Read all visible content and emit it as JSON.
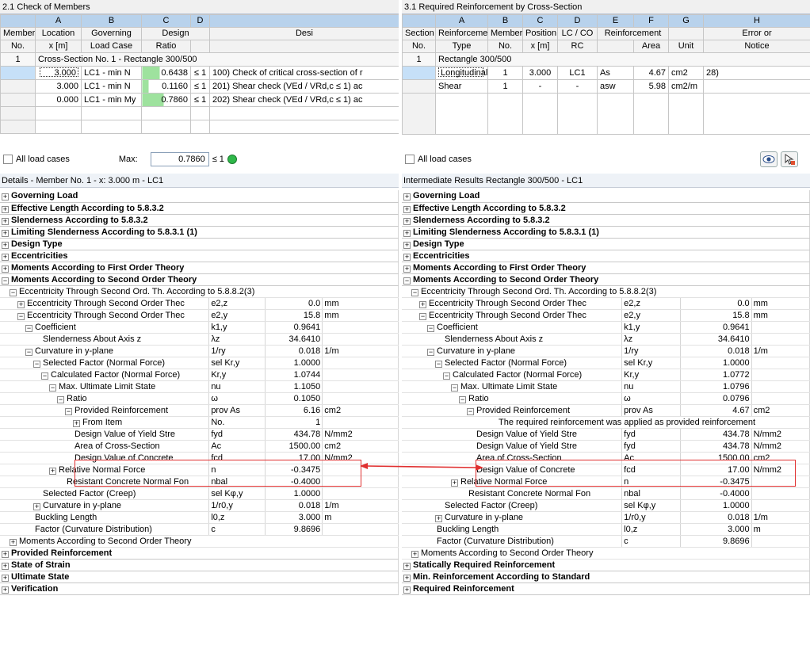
{
  "left": {
    "title": "2.1 Check of Members",
    "letters": [
      "A",
      "B",
      "C",
      "D"
    ],
    "header1": [
      "Member",
      "Location",
      "Governing",
      "Design",
      "",
      "Desi"
    ],
    "header2": [
      "No.",
      "x [m]",
      "Load Case",
      "Ratio",
      ""
    ],
    "group_no": "1",
    "group_label": "Cross-Section No. 1 - Rectangle 300/500",
    "rows": [
      {
        "x": "3.000",
        "lc": "LC1 - min N",
        "ratio": "0.6438",
        "le": "≤ 1",
        "desc": "100) Check of critical cross-section of r"
      },
      {
        "x": "3.000",
        "lc": "LC1 - min N",
        "ratio": "0.1160",
        "le": "≤ 1",
        "desc": "201) Shear check (VEd / VRd,c ≤ 1) ac"
      },
      {
        "x": "0.000",
        "lc": "LC1 - min My",
        "ratio": "0.7860",
        "le": "≤ 1",
        "desc": "202) Shear check (VEd / VRd,c ≤ 1) ac"
      }
    ],
    "all_load_cases": "All load cases",
    "max_label": "Max:",
    "max_value": "0.7860",
    "max_le": "≤ 1",
    "details_title": "Details  -  Member No. 1  -  x: 3.000 m  -  LC1"
  },
  "right": {
    "title": "3.1 Required Reinforcement by Cross-Section",
    "letters": [
      "A",
      "B",
      "C",
      "D",
      "E",
      "F",
      "G",
      "H"
    ],
    "header1": [
      "Section",
      "Reinforcement",
      "Member",
      "Position",
      "LC / CO",
      "Reinforcement",
      "",
      "Error or"
    ],
    "header2": [
      "No.",
      "Type",
      "No.",
      "x [m]",
      "RC",
      "Area",
      "Unit",
      "Notice"
    ],
    "group_no": "1",
    "group_label": "Rectangle 300/500",
    "rows": [
      {
        "type": "Longitudinal",
        "member": "1",
        "pos": "3.000",
        "lc": "LC1",
        "sym": "As",
        "area": "4.67",
        "unit": "cm2",
        "note": "28)"
      },
      {
        "type": "Shear",
        "member": "1",
        "pos": "-",
        "lc": "-",
        "sym": "asw",
        "area": "5.98",
        "unit": "cm2/m",
        "note": ""
      }
    ],
    "all_load_cases": "All load cases",
    "details_title": "Intermediate Results Rectangle 300/500 - LC1"
  },
  "tree_left": [
    {
      "t": "Governing Load",
      "bold": true,
      "exp": "+"
    },
    {
      "t": "Effective Length According to 5.8.3.2",
      "bold": true,
      "exp": "+"
    },
    {
      "t": "Slenderness According to 5.8.3.2",
      "bold": true,
      "exp": "+"
    },
    {
      "t": "Limiting Slenderness According to 5.8.3.1 (1)",
      "bold": true,
      "exp": "+"
    },
    {
      "t": "Design Type",
      "bold": true,
      "exp": "+"
    },
    {
      "t": "Eccentricities",
      "bold": true,
      "exp": "+"
    },
    {
      "t": "Moments According to First Order Theory",
      "bold": true,
      "exp": "+"
    },
    {
      "t": "Moments According to Second Order Theory",
      "bold": true,
      "exp": "-"
    },
    {
      "t": "Eccentricity Through Second Ord. Th. According to 5.8.8.2(3)",
      "lvl": 1,
      "exp": "-",
      "span": true
    },
    {
      "t": "Eccentricity Through Second Order Thec",
      "lvl": 2,
      "exp": "+",
      "s": "e2,z",
      "v": "0.0",
      "u": "mm"
    },
    {
      "t": "Eccentricity Through Second Order Thec",
      "lvl": 2,
      "exp": "-",
      "s": "e2,y",
      "v": "15.8",
      "u": "mm"
    },
    {
      "t": "Coefficient",
      "lvl": 3,
      "exp": "-",
      "s": "k1,y",
      "v": "0.9641",
      "u": ""
    },
    {
      "t": "Slenderness About Axis z",
      "lvl": 4,
      "s": "λz",
      "v": "34.6410",
      "u": ""
    },
    {
      "t": "Curvature in y-plane",
      "lvl": 3,
      "exp": "-",
      "s": "1/ry",
      "v": "0.018",
      "u": "1/m"
    },
    {
      "t": "Selected Factor (Normal Force)",
      "lvl": 4,
      "exp": "-",
      "s": "sel Kr,y",
      "v": "1.0000",
      "u": ""
    },
    {
      "t": "Calculated Factor (Normal Force)",
      "lvl": 5,
      "exp": "-",
      "s": "Kr,y",
      "v": "1.0744",
      "u": ""
    },
    {
      "t": "Max. Ultimate Limit State",
      "lvl": 6,
      "exp": "-",
      "s": "nu",
      "v": "1.1050",
      "u": ""
    },
    {
      "t": "Ratio",
      "lvl": 7,
      "exp": "-",
      "s": "ω",
      "v": "0.1050",
      "u": ""
    },
    {
      "t": "Provided Reinforcement",
      "lvl": 8,
      "exp": "-",
      "s": "prov As",
      "v": "6.16",
      "u": "cm2"
    },
    {
      "t": "From Item",
      "lvl": 9,
      "exp": "+",
      "s": "No.",
      "v": "1",
      "u": ""
    },
    {
      "t": "Design Value of Yield Stre",
      "lvl": 8,
      "s": "fyd",
      "v": "434.78",
      "u": "N/mm2"
    },
    {
      "t": "Area of Cross-Section",
      "lvl": 8,
      "s": "Ac",
      "v": "1500.00",
      "u": "cm2"
    },
    {
      "t": "Design Value of Concrete",
      "lvl": 8,
      "s": "fcd",
      "v": "17.00",
      "u": "N/mm2"
    },
    {
      "t": "Relative Normal Force",
      "lvl": 6,
      "exp": "+",
      "s": "n",
      "v": "-0.3475",
      "u": ""
    },
    {
      "t": "Resistant Concrete Normal Fon",
      "lvl": 7,
      "s": "nbal",
      "v": "-0.4000",
      "u": ""
    },
    {
      "t": "Selected Factor (Creep)",
      "lvl": 4,
      "s": "sel Kφ,y",
      "v": "1.0000",
      "u": ""
    },
    {
      "t": "Curvature in y-plane",
      "lvl": 4,
      "exp": "+",
      "s": "1/r0,y",
      "v": "0.018",
      "u": "1/m"
    },
    {
      "t": "Buckling Length",
      "lvl": 3,
      "s": "l0,z",
      "v": "3.000",
      "u": "m"
    },
    {
      "t": "Factor (Curvature Distribution)",
      "lvl": 3,
      "s": "c",
      "v": "9.8696",
      "u": ""
    },
    {
      "t": "Moments According to Second Order Theory",
      "lvl": 1,
      "exp": "+",
      "span": true
    },
    {
      "t": "Provided Reinforcement",
      "bold": true,
      "exp": "+"
    },
    {
      "t": "State of Strain",
      "bold": true,
      "exp": "+"
    },
    {
      "t": "Ultimate State",
      "bold": true,
      "exp": "+"
    },
    {
      "t": "Verification",
      "bold": true,
      "exp": "+"
    }
  ],
  "tree_right": [
    {
      "t": "Governing Load",
      "bold": true,
      "exp": "+"
    },
    {
      "t": "Effective Length According to 5.8.3.2",
      "bold": true,
      "exp": "+"
    },
    {
      "t": "Slenderness According to 5.8.3.2",
      "bold": true,
      "exp": "+"
    },
    {
      "t": "Limiting Slenderness According to 5.8.3.1 (1)",
      "bold": true,
      "exp": "+"
    },
    {
      "t": "Design Type",
      "bold": true,
      "exp": "+"
    },
    {
      "t": "Eccentricities",
      "bold": true,
      "exp": "+"
    },
    {
      "t": "Moments According to First Order Theory",
      "bold": true,
      "exp": "+"
    },
    {
      "t": "Moments According to Second Order Theory",
      "bold": true,
      "exp": "-"
    },
    {
      "t": "Eccentricity Through Second Ord. Th. According to 5.8.8.2(3)",
      "lvl": 1,
      "exp": "-",
      "span": true
    },
    {
      "t": "Eccentricity Through Second Order Thec",
      "lvl": 2,
      "exp": "+",
      "s": "e2,z",
      "v": "0.0",
      "u": "mm"
    },
    {
      "t": "Eccentricity Through Second Order Thec",
      "lvl": 2,
      "exp": "-",
      "s": "e2,y",
      "v": "15.8",
      "u": "mm"
    },
    {
      "t": "Coefficient",
      "lvl": 3,
      "exp": "-",
      "s": "k1,y",
      "v": "0.9641",
      "u": ""
    },
    {
      "t": "Slenderness About Axis z",
      "lvl": 4,
      "s": "λz",
      "v": "34.6410",
      "u": ""
    },
    {
      "t": "Curvature in y-plane",
      "lvl": 3,
      "exp": "-",
      "s": "1/ry",
      "v": "0.018",
      "u": "1/m"
    },
    {
      "t": "Selected Factor (Normal Force)",
      "lvl": 4,
      "exp": "-",
      "s": "sel Kr,y",
      "v": "1.0000",
      "u": ""
    },
    {
      "t": "Calculated Factor (Normal Force)",
      "lvl": 5,
      "exp": "-",
      "s": "Kr,y",
      "v": "1.0772",
      "u": ""
    },
    {
      "t": "Max. Ultimate Limit State",
      "lvl": 6,
      "exp": "-",
      "s": "nu",
      "v": "1.0796",
      "u": ""
    },
    {
      "t": "Ratio",
      "lvl": 7,
      "exp": "-",
      "s": "ω",
      "v": "0.0796",
      "u": ""
    },
    {
      "t": "Provided Reinforcement",
      "lvl": 8,
      "exp": "-",
      "s": "prov As",
      "v": "4.67",
      "u": "cm2"
    },
    {
      "t": "The required reinforcement was applied as provided reinforcement",
      "lvl": 9,
      "span": true
    },
    {
      "t": "Design Value of Yield Stre",
      "lvl": 8,
      "s": "fyd",
      "v": "434.78",
      "u": "N/mm2"
    },
    {
      "t": "Design Value of Yield Stre",
      "lvl": 8,
      "s": "fyd",
      "v": "434.78",
      "u": "N/mm2"
    },
    {
      "t": "Area of Cross-Section",
      "lvl": 8,
      "s": "Ac",
      "v": "1500.00",
      "u": "cm2"
    },
    {
      "t": "Design Value of Concrete",
      "lvl": 8,
      "s": "fcd",
      "v": "17.00",
      "u": "N/mm2"
    },
    {
      "t": "Relative Normal Force",
      "lvl": 6,
      "exp": "+",
      "s": "n",
      "v": "-0.3475",
      "u": ""
    },
    {
      "t": "Resistant Concrete Normal Fon",
      "lvl": 7,
      "s": "nbal",
      "v": "-0.4000",
      "u": ""
    },
    {
      "t": "Selected Factor (Creep)",
      "lvl": 4,
      "s": "sel Kφ,y",
      "v": "1.0000",
      "u": ""
    },
    {
      "t": "Curvature in y-plane",
      "lvl": 4,
      "exp": "+",
      "s": "1/r0,y",
      "v": "0.018",
      "u": "1/m"
    },
    {
      "t": "Buckling Length",
      "lvl": 3,
      "s": "l0,z",
      "v": "3.000",
      "u": "m"
    },
    {
      "t": "Factor (Curvature Distribution)",
      "lvl": 3,
      "s": "c",
      "v": "9.8696",
      "u": ""
    },
    {
      "t": "Moments According to Second Order Theory",
      "lvl": 1,
      "exp": "+",
      "span": true
    },
    {
      "t": "Statically Required Reinforcement",
      "bold": true,
      "exp": "+"
    },
    {
      "t": "Min. Reinforcement According to Standard",
      "bold": true,
      "exp": "+"
    },
    {
      "t": "Required Reinforcement",
      "bold": true,
      "exp": "+"
    }
  ],
  "colors": {
    "highlight": "#e03030",
    "ratio_bar": "#9ee29e",
    "status_ok": "#2fb84a"
  }
}
